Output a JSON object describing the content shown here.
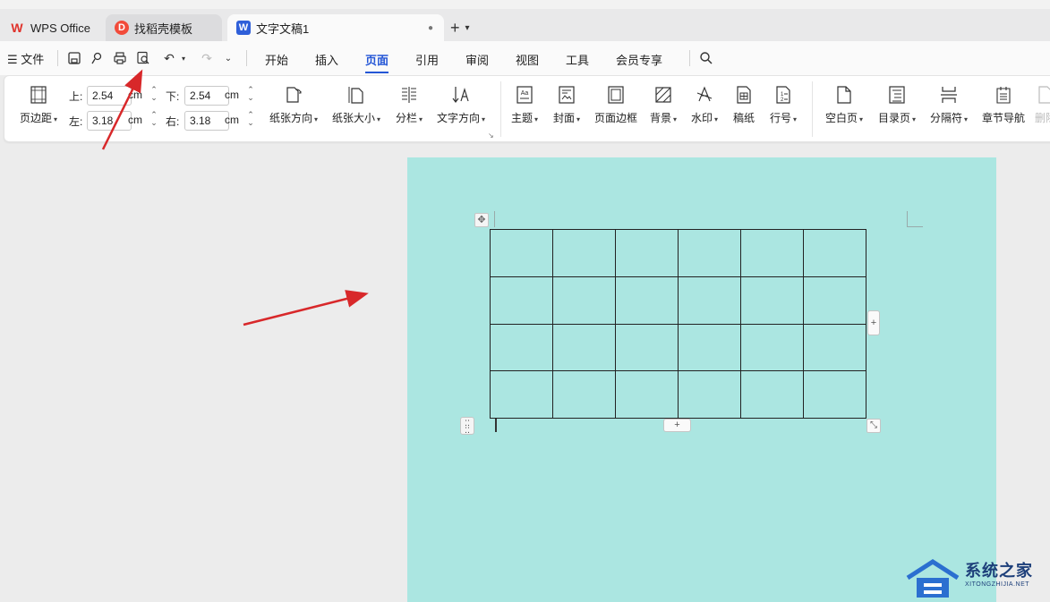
{
  "tabs": {
    "wps": "WPS Office",
    "template": "找稻壳模板",
    "document": "文字文稿1",
    "new_tab_symbol": "+",
    "dropdown_symbol": "⌄"
  },
  "menu": {
    "hamburger": "☰",
    "file_label": "文件",
    "tabs": [
      "开始",
      "插入",
      "页面",
      "引用",
      "审阅",
      "视图",
      "工具",
      "会员专享"
    ],
    "active_tab": "页面"
  },
  "ribbon": {
    "page_margin_label": "页边距",
    "margins": {
      "top_label": "上:",
      "top_value": "2.54",
      "bottom_label": "下:",
      "bottom_value": "2.54",
      "left_label": "左:",
      "left_value": "3.18",
      "right_label": "右:",
      "right_value": "3.18",
      "unit": "cm"
    },
    "orientation": "纸张方向",
    "size": "纸张大小",
    "columns": "分栏",
    "text_direction": "文字方向",
    "theme": "主题",
    "cover": "封面",
    "page_border": "页面边框",
    "background": "背景",
    "watermark": "水印",
    "manuscript": "稿纸",
    "line_number": "行号",
    "blank_page": "空白页",
    "toc_page": "目录页",
    "separator": "分隔符",
    "chapter_nav": "章节导航",
    "delete": "删除"
  },
  "table": {
    "rows": 4,
    "cols": 6,
    "add_symbol": "+"
  },
  "watermark": {
    "title": "系统之家",
    "url": "XITONGZHIJIA.NET"
  },
  "colors": {
    "page_background": "#abe6e1",
    "active_tab": "#2456d6",
    "annotation_arrow": "#d8282a"
  }
}
